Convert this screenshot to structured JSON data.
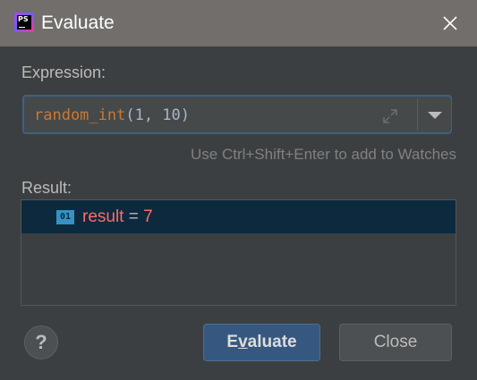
{
  "window": {
    "title": "Evaluate",
    "app_icon_text": "PS",
    "app_icon": "phpstorm-logo",
    "close_icon": "close-icon"
  },
  "expression": {
    "label": "Expression:",
    "function_name": "random_int",
    "args": "(1, 10)",
    "expand_icon": "expand-icon",
    "dropdown_icon": "chevron-down-icon"
  },
  "hint": "Use Ctrl+Shift+Enter to add to Watches",
  "result": {
    "label": "Result:",
    "type_icon_text": "01",
    "name": "result",
    "eq": "=",
    "value": "7"
  },
  "buttons": {
    "help": "?",
    "evaluate_prefix": "E",
    "evaluate_mnemonic": "v",
    "evaluate_rest": "aluate",
    "close": "Close"
  },
  "colors": {
    "titlebar": "#726e6b",
    "background": "#3c3f41",
    "primary_button": "#365880",
    "selection": "#0d293e",
    "result_value": "#ff6b68",
    "function_name": "#cc7832"
  }
}
